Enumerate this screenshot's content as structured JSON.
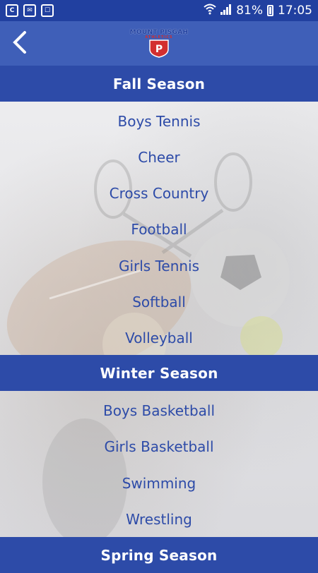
{
  "status_bar": {
    "battery": "81%",
    "time": "17:05"
  },
  "app_bar": {
    "logo_line1": "MOUNT PISGAH",
    "logo_line2": "ATHLETICS",
    "logo_mark": "P"
  },
  "sections": [
    {
      "title": "Fall Season",
      "items": [
        "Boys Tennis",
        "Cheer",
        "Cross Country",
        "Football",
        "Girls Tennis",
        "Softball",
        "Volleyball"
      ]
    },
    {
      "title": "Winter Season",
      "items": [
        "Boys Basketball",
        "Girls Basketball",
        "Swimming",
        "Wrestling"
      ]
    },
    {
      "title": "Spring Season",
      "items": []
    }
  ],
  "colors": {
    "primary": "#2d4ba8",
    "appbar": "#3f5fb8",
    "statusbar": "#2140a0",
    "accent": "#d32f2f"
  }
}
